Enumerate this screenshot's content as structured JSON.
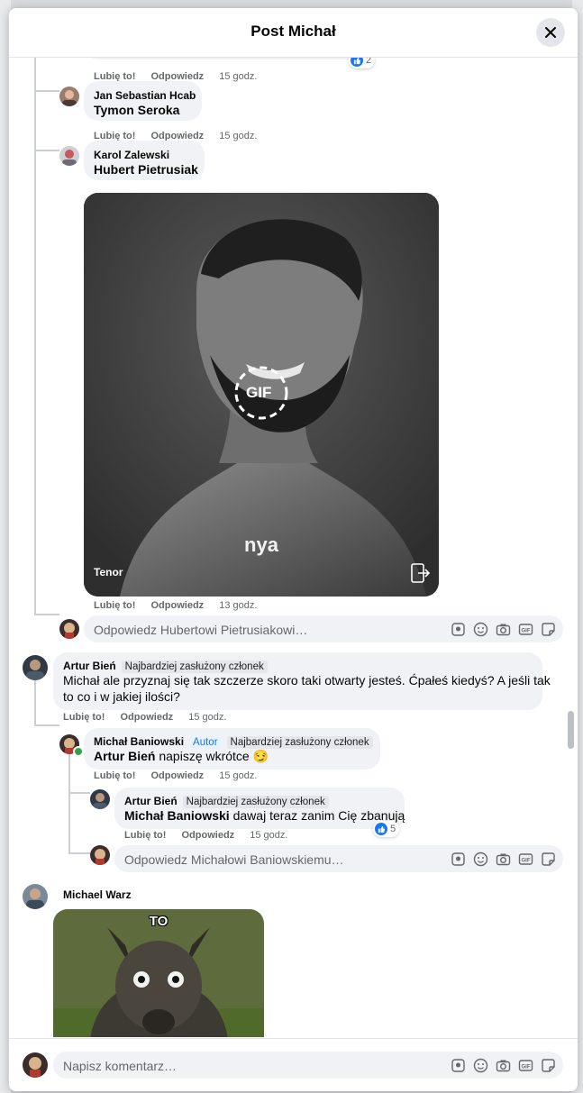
{
  "modal": {
    "title": "Post Michał"
  },
  "actions": {
    "like": "Lubię to!",
    "reply": "Odpowiedz"
  },
  "top_comment_tail": {
    "time": "15 godz.",
    "reactions": "2"
  },
  "comments": [
    {
      "author": "Jan Sebastian Hcab",
      "mention": "Tymon Seroka",
      "time": "15 godz."
    },
    {
      "author": "Karol Zalewski",
      "mention": "Hubert Pietrusiak",
      "time": "13 godz.",
      "gif": {
        "caption": "nya",
        "badge": "GIF",
        "source": "Tenor"
      }
    },
    {
      "author": "Artur Bień",
      "badge": "Najbardziej zasłużony członek",
      "text_line1": "Michał ale przyznaj się tak szczerze skoro taki otwarty jesteś. Ćpałeś kiedyś? A jeśli tak",
      "text_line2": "to co i w jakiej ilości?",
      "time": "15 godz."
    },
    {
      "author": "Michał Baniowski",
      "author_badge": "Autor",
      "badge": "Najbardziej zasłużony członek",
      "mention": "Artur Bień",
      "text": "napiszę wkrótce 😏",
      "time": "15 godz."
    },
    {
      "author": "Artur Bień",
      "badge": "Najbardziej zasłużony członek",
      "mention": "Michał Baniowski",
      "text": "dawaj teraz zanim Cię zbanują",
      "time": "15 godz.",
      "reactions": "5"
    },
    {
      "author": "Michael Warz",
      "image_caption": "TO"
    }
  ],
  "reply_inputs": {
    "hubert": "Odpowiedz Hubertowi Pietrusiakowi…",
    "michal": "Odpowiedz Michałowi Baniowskiemu…"
  },
  "footer": {
    "placeholder": "Napisz komentarz…"
  },
  "icons": [
    "close-icon",
    "avatar-sticker-icon",
    "emoji-icon",
    "camera-icon",
    "gif-icon",
    "sticker-icon",
    "like-icon",
    "share-icon"
  ],
  "colors": {
    "like_blue": "#1877f2",
    "bubble": "#f0f2f5",
    "secondary_text": "#65676b"
  }
}
